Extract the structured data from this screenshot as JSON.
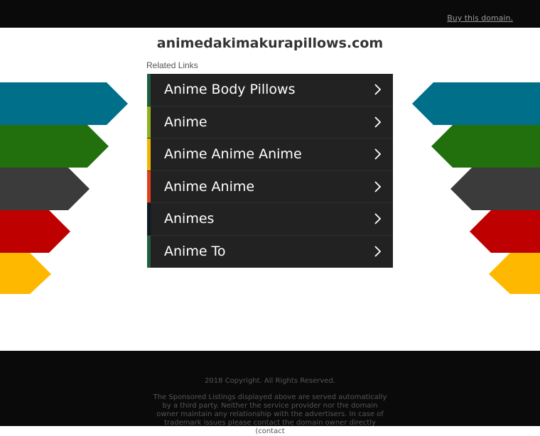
{
  "header": {
    "buy_link": "Buy this domain."
  },
  "domain_title": "animedakimakurapillows.com",
  "related": {
    "label": "Related Links",
    "items": [
      {
        "label": "Anime Body Pillows",
        "accent": "#1f5e3e"
      },
      {
        "label": "Anime",
        "accent": "#8fb320"
      },
      {
        "label": "Anime Anime Anime",
        "accent": "#f2b600"
      },
      {
        "label": "Anime Anime",
        "accent": "#e0401a"
      },
      {
        "label": "Animes",
        "accent": "#0b1a24"
      },
      {
        "label": "Anime To",
        "accent": "#1f5e3e"
      }
    ]
  },
  "colors": {
    "arrow_blue": "#006f8a",
    "arrow_green": "#22700d",
    "arrow_gray": "#3b3b3b",
    "arrow_red": "#bf0000",
    "arrow_yellow": "#ffb800"
  },
  "footer": {
    "copyright": "2018 Copyright. All Rights Reserved.",
    "disclaimer": "The Sponsored Listings displayed above are served automatically by a third party. Neither the service provider nor the domain owner maintain any relationship with the advertisers. In case of trademark issues please contact the domain owner directly (contact"
  }
}
